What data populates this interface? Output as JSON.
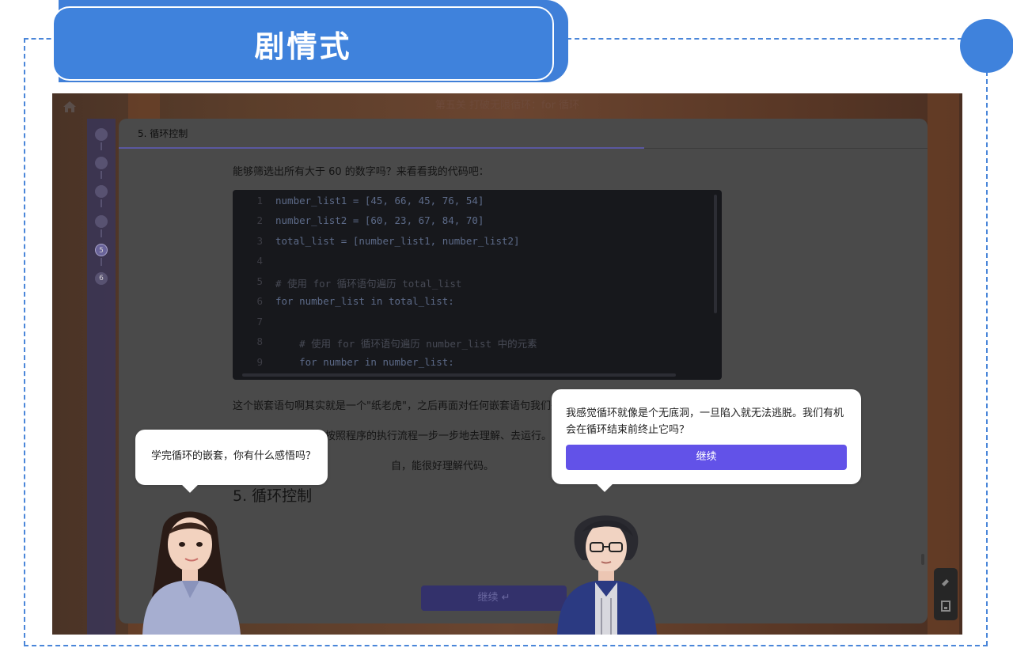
{
  "banner": {
    "title": "剧情式"
  },
  "screen": {
    "title": "第五关 打破无限循环：for 循环",
    "progress_steps": [
      "",
      "",
      "",
      "",
      "5",
      "6"
    ],
    "active_step": 5
  },
  "panel": {
    "header": "5. 循环控制",
    "intro": "能够筛选出所有大于 60 的数字吗？来看看我的代码吧：",
    "code_lines": [
      {
        "n": "1",
        "text": "number_list1 = [45, 66, 45, 76, 54]"
      },
      {
        "n": "2",
        "text": "number_list2 = [60, 23, 67, 84, 70]"
      },
      {
        "n": "3",
        "text": "total_list = [number_list1, number_list2]"
      },
      {
        "n": "4",
        "text": ""
      },
      {
        "n": "5",
        "text": "# 使用 for 循环语句遍历 total_list"
      },
      {
        "n": "6",
        "text": "for number_list in total_list:"
      },
      {
        "n": "7",
        "text": ""
      },
      {
        "n": "8",
        "text": "    # 使用 for 循环语句遍历 number_list 中的元素"
      },
      {
        "n": "9",
        "text": "    for number in number_list:"
      }
    ],
    "paragraph_1": "这个嵌套语句啊其实就是一个\"纸老虎\"，之后再面对任何嵌套语句我们完",
    "paragraph_2": "你都会按照执行的，按照程序的执行流程一步一步地去理解、去运行。",
    "paragraph_3": "自，能很好理解代码。",
    "section_heading": "5. 循环控制",
    "continue_label": "继续 ↵"
  },
  "dialog": {
    "left_text": "学完循环的嵌套，你有什么感悟吗？",
    "right_text": "我感觉循环就像是个无底洞，一旦陷入就无法逃脱。我们有机会在循环结束前终止它吗？",
    "continue_button": "继续"
  },
  "colors": {
    "accent_blue": "#3f82dc",
    "button_purple": "#6252e8"
  },
  "icons": [
    "home-icon",
    "eraser-icon",
    "save-icon"
  ]
}
